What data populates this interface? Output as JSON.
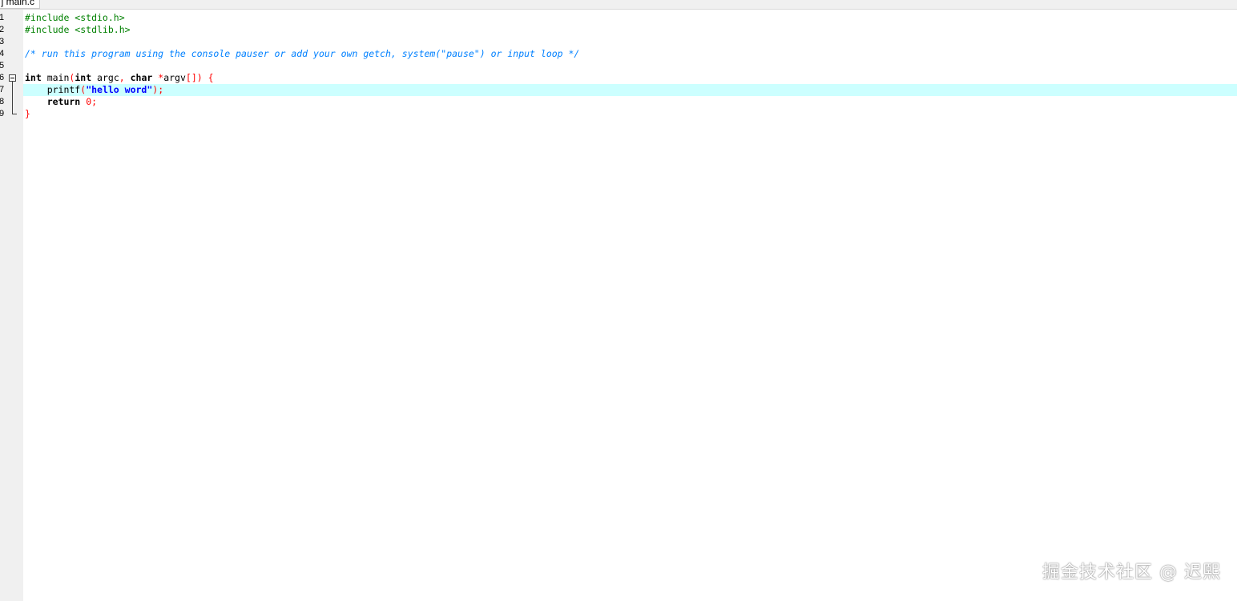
{
  "tab": {
    "label": "] main.c"
  },
  "editor": {
    "lines": [
      {
        "n": "1",
        "tokens": [
          {
            "t": "pre",
            "v": "#include <stdio.h>"
          }
        ]
      },
      {
        "n": "2",
        "tokens": [
          {
            "t": "pre",
            "v": "#include <stdlib.h>"
          }
        ]
      },
      {
        "n": "3",
        "tokens": []
      },
      {
        "n": "4",
        "tokens": [
          {
            "t": "cmt",
            "v": "/* run this program using the console pauser or add your own getch, system(\"pause\") or input loop */"
          }
        ]
      },
      {
        "n": "5",
        "tokens": []
      },
      {
        "n": "6",
        "tokens": [
          {
            "t": "kw",
            "v": "int"
          },
          {
            "t": "id",
            "v": " main"
          },
          {
            "t": "sym",
            "v": "("
          },
          {
            "t": "kw",
            "v": "int"
          },
          {
            "t": "id",
            "v": " argc"
          },
          {
            "t": "sym",
            "v": ","
          },
          {
            "t": "id",
            "v": " "
          },
          {
            "t": "kw",
            "v": "char"
          },
          {
            "t": "id",
            "v": " "
          },
          {
            "t": "sym",
            "v": "*"
          },
          {
            "t": "id",
            "v": "argv"
          },
          {
            "t": "sym",
            "v": "[])"
          },
          {
            "t": "id",
            "v": " "
          },
          {
            "t": "sym",
            "v": "{"
          }
        ]
      },
      {
        "n": "7",
        "tokens": [
          {
            "t": "id",
            "v": "    printf"
          },
          {
            "t": "sym",
            "v": "("
          },
          {
            "t": "str",
            "v": "\"hello word\""
          },
          {
            "t": "sym",
            "v": ");"
          }
        ]
      },
      {
        "n": "8",
        "tokens": [
          {
            "t": "kw",
            "v": "    return"
          },
          {
            "t": "id",
            "v": " "
          },
          {
            "t": "num",
            "v": "0"
          },
          {
            "t": "sym",
            "v": ";"
          }
        ]
      },
      {
        "n": "9",
        "tokens": [
          {
            "t": "sym",
            "v": "}"
          }
        ]
      }
    ],
    "active_line": "7",
    "fold_start_line": "6",
    "fold_end_line": "9"
  },
  "watermark": {
    "text": "掘金技术社区 @ 迟熙"
  }
}
